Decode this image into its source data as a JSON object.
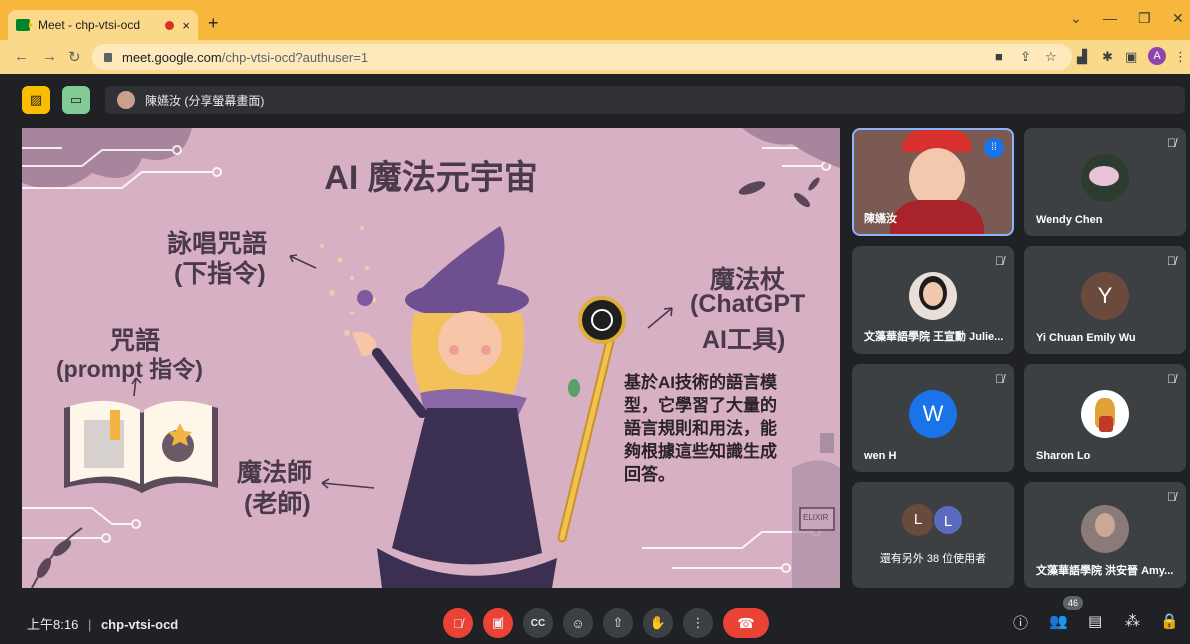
{
  "browser": {
    "tab_title": "Meet - chp-vtsi-ocd",
    "tab_close": "×",
    "new_tab": "+",
    "url_host": "meet.google.com",
    "url_path": "/chp-vtsi-ocd?authuser=1",
    "profile_initial": "A",
    "accent": "#f6b73c"
  },
  "meet": {
    "presenter_label": "陳嬿汝 (分享螢幕畫面)",
    "slide": {
      "title": "AI 魔法元宇宙",
      "chant_l1": "詠唱咒語",
      "chant_l2": "(下指令)",
      "spell_l1": "咒語",
      "spell_l2": "(prompt  指令)",
      "wand_l1": "魔法杖",
      "wand_l2": "(ChatGPT",
      "wand_l3": "AI工具)",
      "desc_l1": "基於AI技術的語言模",
      "desc_l2": "型，它學習了大量的",
      "desc_l3": "語言規則和用法，能",
      "desc_l4": "夠根據這些知識生成",
      "desc_l5": "回答。",
      "mage_l1": "魔法師",
      "mage_l2": "(老師)",
      "bottle_label": "ELIXIR"
    },
    "participants": [
      {
        "name": "陳嬿汝"
      },
      {
        "name": "Wendy Chen"
      },
      {
        "name": "文藻華語學院 王宣勳 Julie..."
      },
      {
        "name": "Yi Chuan Emily Wu",
        "initial": "Y"
      },
      {
        "name": "wen H",
        "initial": "W"
      },
      {
        "name": "Sharon Lo"
      },
      {
        "name": "還有另外 38 位使用者",
        "initials": [
          "L",
          "L"
        ]
      },
      {
        "name": "文藻華語學院 洪安晉 Amy..."
      }
    ],
    "bottom": {
      "time": "上午8:16",
      "separator": "|",
      "meeting_code": "chp-vtsi-ocd",
      "people_count": "46"
    }
  }
}
